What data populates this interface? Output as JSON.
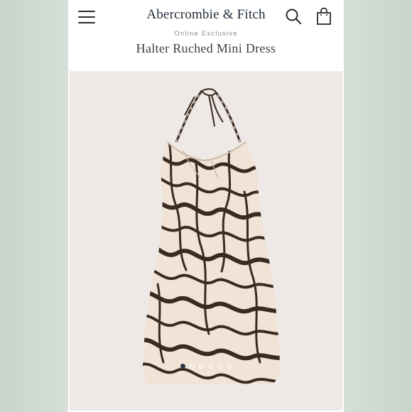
{
  "header": {
    "brand": "Abercrombie & Fitch"
  },
  "product": {
    "eyebrow": "Online Exclusive",
    "title": "Halter Ruched Mini Dress",
    "image_count": 6,
    "active_image_index": 0
  },
  "icons": {
    "menu": "hamburger-menu-icon",
    "search": "search-icon",
    "bag": "shopping-bag-icon"
  },
  "colors": {
    "brand_text": "#1f2a38",
    "dress_base": "#f1e4d7",
    "dress_print": "#3b2a22",
    "gallery_bg": "#eee9e6",
    "active_dot": "#2c3848"
  }
}
